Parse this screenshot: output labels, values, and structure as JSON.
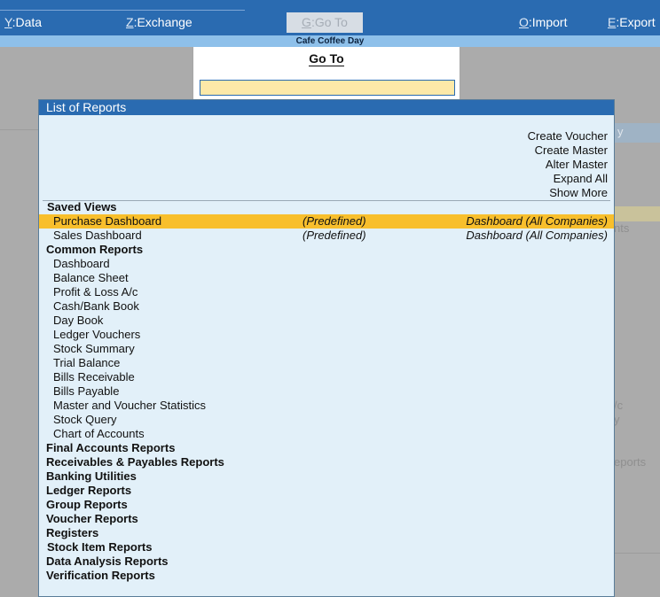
{
  "topbar": {
    "menus": [
      {
        "key": "Y",
        "label": "Data"
      },
      {
        "key": "Z",
        "label": "Exchange"
      },
      {
        "key": "G",
        "label": "Go To"
      },
      {
        "key": "O",
        "label": "Import"
      },
      {
        "key": "E",
        "label": "Export"
      }
    ]
  },
  "company": "Cafe Coffee Day",
  "background_text": [
    "y",
    "nts",
    "/c",
    "y",
    "eports"
  ],
  "goto": {
    "title": "Go To",
    "input_value": ""
  },
  "reports": {
    "title": "List of Reports",
    "actions": [
      "Create Voucher",
      "Create Master",
      "Alter Master",
      "Expand All",
      "Show More"
    ],
    "saved_views_label": "Saved Views",
    "saved_views": [
      {
        "name": "Purchase Dashboard",
        "tag": "(Predefined)",
        "type": "Dashboard (All Companies)",
        "selected": true
      },
      {
        "name": "Sales Dashboard",
        "tag": "(Predefined)",
        "type": "Dashboard (All Companies)",
        "selected": false
      }
    ],
    "common_reports_label": "Common Reports",
    "common_reports": [
      "Dashboard",
      "Balance Sheet",
      "Profit & Loss A/c",
      "Cash/Bank Book",
      "Day Book",
      "Ledger Vouchers",
      "Stock Summary",
      "Trial Balance",
      "Bills Receivable",
      "Bills Payable",
      "Master and Voucher Statistics",
      "Stock Query",
      "Chart of Accounts"
    ],
    "categories": [
      "Final Accounts Reports",
      "Receivables & Payables Reports",
      "Banking Utilities",
      "Ledger Reports",
      "Group Reports",
      "Voucher Reports",
      "Registers",
      "Stock Item Reports",
      "Data Analysis Reports",
      "Verification Reports"
    ]
  },
  "colors": {
    "accent": "#2a6bb1",
    "company_bar": "#8ec0ea",
    "panel": "#e2f0f9",
    "selection": "#f8bf2c",
    "input": "#fde9a8"
  }
}
